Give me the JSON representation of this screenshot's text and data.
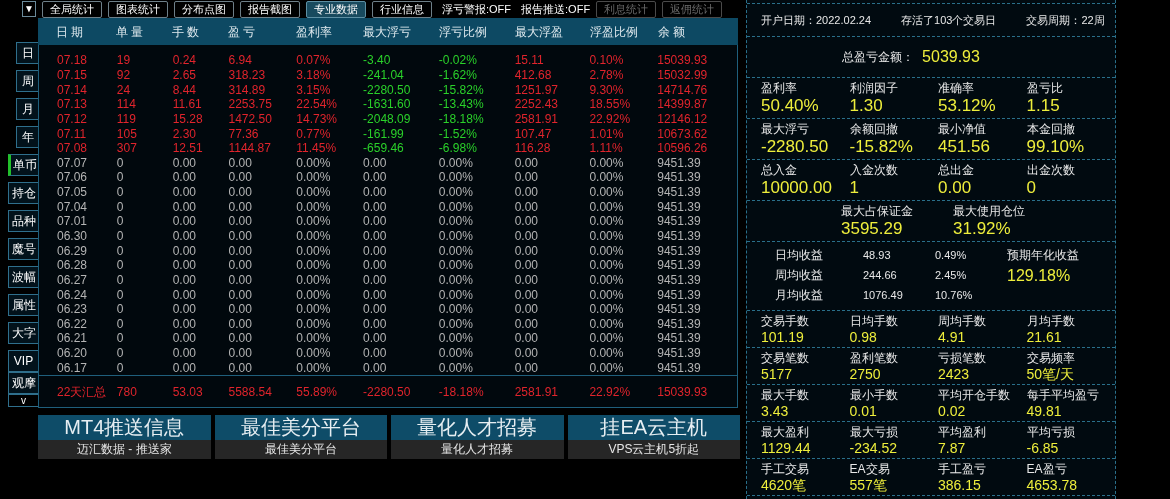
{
  "toolbar": {
    "menu_button": "▼",
    "buttons": [
      {
        "label": "全局统计",
        "selected": false,
        "disabled": false
      },
      {
        "label": "图表统计",
        "selected": false,
        "disabled": false
      },
      {
        "label": "分布点图",
        "selected": false,
        "disabled": false
      },
      {
        "label": "报告截图",
        "selected": false,
        "disabled": false
      },
      {
        "label": "专业数据",
        "selected": true,
        "disabled": false
      },
      {
        "label": "行业信息",
        "selected": false,
        "disabled": false
      }
    ],
    "statuses": [
      "浮亏警报:OFF",
      "报告推送:OFF"
    ],
    "extra_buttons": [
      {
        "label": "利息统计",
        "selected": false,
        "disabled": true
      },
      {
        "label": "返佣统计",
        "selected": false,
        "disabled": true
      }
    ]
  },
  "sidebar": {
    "period_tabs": [
      {
        "label": "日",
        "selected": false
      },
      {
        "label": "周",
        "selected": false
      },
      {
        "label": "月",
        "selected": false
      },
      {
        "label": "年",
        "selected": false
      }
    ],
    "view_tabs": [
      {
        "label": "单币",
        "selected": true
      },
      {
        "label": "持仓",
        "selected": false
      },
      {
        "label": "品种",
        "selected": false
      },
      {
        "label": "魔号",
        "selected": false
      },
      {
        "label": "波幅",
        "selected": false
      },
      {
        "label": "属性",
        "selected": false
      },
      {
        "label": "大字",
        "selected": false
      },
      {
        "label": "VIP",
        "selected": false
      },
      {
        "label": "观摩",
        "selected": false
      }
    ],
    "more": "v"
  },
  "table": {
    "columns": [
      "日 期",
      "单 量",
      "手 数",
      "盈 亏",
      "盈利率",
      "最大浮亏",
      "浮亏比例",
      "最大浮盈",
      "浮盈比例",
      "余 额"
    ],
    "rows": [
      {
        "kind": "trade",
        "cells": [
          "07.18",
          "19",
          "0.24",
          "6.94",
          "0.07%",
          "-3.40",
          "-0.02%",
          "15.11",
          "0.10%",
          "15039.93"
        ]
      },
      {
        "kind": "trade",
        "cells": [
          "07.15",
          "92",
          "2.65",
          "318.23",
          "3.18%",
          "-241.04",
          "-1.62%",
          "412.68",
          "2.78%",
          "15032.99"
        ]
      },
      {
        "kind": "trade",
        "cells": [
          "07.14",
          "24",
          "8.44",
          "314.89",
          "3.15%",
          "-2280.50",
          "-15.82%",
          "1251.97",
          "9.30%",
          "14714.76"
        ]
      },
      {
        "kind": "trade",
        "cells": [
          "07.13",
          "114",
          "11.61",
          "2253.75",
          "22.54%",
          "-1631.60",
          "-13.43%",
          "2252.43",
          "18.55%",
          "14399.87"
        ]
      },
      {
        "kind": "trade",
        "cells": [
          "07.12",
          "119",
          "15.28",
          "1472.50",
          "14.73%",
          "-2048.09",
          "-18.18%",
          "2581.91",
          "22.92%",
          "12146.12"
        ]
      },
      {
        "kind": "trade",
        "cells": [
          "07.11",
          "105",
          "2.30",
          "77.36",
          "0.77%",
          "-161.99",
          "-1.52%",
          "107.47",
          "1.01%",
          "10673.62"
        ]
      },
      {
        "kind": "trade",
        "cells": [
          "07.08",
          "307",
          "12.51",
          "1144.87",
          "11.45%",
          "-659.46",
          "-6.98%",
          "116.28",
          "1.11%",
          "10596.26"
        ]
      },
      {
        "kind": "idle",
        "cells": [
          "07.07",
          "0",
          "0.00",
          "0.00",
          "0.00%",
          "0.00",
          "0.00%",
          "0.00",
          "0.00%",
          "9451.39"
        ]
      },
      {
        "kind": "idle",
        "cells": [
          "07.06",
          "0",
          "0.00",
          "0.00",
          "0.00%",
          "0.00",
          "0.00%",
          "0.00",
          "0.00%",
          "9451.39"
        ]
      },
      {
        "kind": "idle",
        "cells": [
          "07.05",
          "0",
          "0.00",
          "0.00",
          "0.00%",
          "0.00",
          "0.00%",
          "0.00",
          "0.00%",
          "9451.39"
        ]
      },
      {
        "kind": "idle",
        "cells": [
          "07.04",
          "0",
          "0.00",
          "0.00",
          "0.00%",
          "0.00",
          "0.00%",
          "0.00",
          "0.00%",
          "9451.39"
        ]
      },
      {
        "kind": "idle",
        "cells": [
          "07.01",
          "0",
          "0.00",
          "0.00",
          "0.00%",
          "0.00",
          "0.00%",
          "0.00",
          "0.00%",
          "9451.39"
        ]
      },
      {
        "kind": "idle",
        "cells": [
          "06.30",
          "0",
          "0.00",
          "0.00",
          "0.00%",
          "0.00",
          "0.00%",
          "0.00",
          "0.00%",
          "9451.39"
        ]
      },
      {
        "kind": "idle",
        "cells": [
          "06.29",
          "0",
          "0.00",
          "0.00",
          "0.00%",
          "0.00",
          "0.00%",
          "0.00",
          "0.00%",
          "9451.39"
        ]
      },
      {
        "kind": "idle",
        "cells": [
          "06.28",
          "0",
          "0.00",
          "0.00",
          "0.00%",
          "0.00",
          "0.00%",
          "0.00",
          "0.00%",
          "9451.39"
        ]
      },
      {
        "kind": "idle",
        "cells": [
          "06.27",
          "0",
          "0.00",
          "0.00",
          "0.00%",
          "0.00",
          "0.00%",
          "0.00",
          "0.00%",
          "9451.39"
        ]
      },
      {
        "kind": "idle",
        "cells": [
          "06.24",
          "0",
          "0.00",
          "0.00",
          "0.00%",
          "0.00",
          "0.00%",
          "0.00",
          "0.00%",
          "9451.39"
        ]
      },
      {
        "kind": "idle",
        "cells": [
          "06.23",
          "0",
          "0.00",
          "0.00",
          "0.00%",
          "0.00",
          "0.00%",
          "0.00",
          "0.00%",
          "9451.39"
        ]
      },
      {
        "kind": "idle",
        "cells": [
          "06.22",
          "0",
          "0.00",
          "0.00",
          "0.00%",
          "0.00",
          "0.00%",
          "0.00",
          "0.00%",
          "9451.39"
        ]
      },
      {
        "kind": "idle",
        "cells": [
          "06.21",
          "0",
          "0.00",
          "0.00",
          "0.00%",
          "0.00",
          "0.00%",
          "0.00",
          "0.00%",
          "9451.39"
        ]
      },
      {
        "kind": "idle",
        "cells": [
          "06.20",
          "0",
          "0.00",
          "0.00",
          "0.00%",
          "0.00",
          "0.00%",
          "0.00",
          "0.00%",
          "9451.39"
        ]
      },
      {
        "kind": "idle",
        "cells": [
          "06.17",
          "0",
          "0.00",
          "0.00",
          "0.00%",
          "0.00",
          "0.00%",
          "0.00",
          "0.00%",
          "9451.39"
        ]
      }
    ],
    "summary": [
      "22天汇总",
      "780",
      "53.03",
      "5588.54",
      "55.89%",
      "-2280.50",
      "-18.18%",
      "2581.91",
      "22.92%",
      "15039.93"
    ]
  },
  "ads": [
    {
      "title": "MT4推送信息",
      "subtitle": "迈汇数据 - 推送家"
    },
    {
      "title": "最佳美分平台",
      "subtitle": "最佳美分平台"
    },
    {
      "title": "量化人才招募",
      "subtitle": "量化人才招募"
    },
    {
      "title": "挂EA云主机",
      "subtitle": "VPS云主机5折起"
    }
  ],
  "report": {
    "account": [
      "开户日期：2022.02.24",
      "存活了103个交易日",
      "交易周期：22周"
    ],
    "total": {
      "label": "总盈亏金额：",
      "value": "5039.93"
    },
    "sections": [
      {
        "kind": "grid",
        "items": [
          {
            "label": "盈利率",
            "value": "50.40%"
          },
          {
            "label": "利润因子",
            "value": "1.30"
          },
          {
            "label": "准确率",
            "value": "53.12%"
          },
          {
            "label": "盈亏比",
            "value": "1.15"
          }
        ]
      },
      {
        "kind": "grid",
        "items": [
          {
            "label": "最大浮亏",
            "value": "-2280.50"
          },
          {
            "label": "余额回撤",
            "value": "-15.82%"
          },
          {
            "label": "最小净值",
            "value": "451.56"
          },
          {
            "label": "本金回撤",
            "value": "99.10%"
          }
        ]
      },
      {
        "kind": "grid",
        "items": [
          {
            "label": "总入金",
            "value": "10000.00"
          },
          {
            "label": "入金次数",
            "value": "1"
          },
          {
            "label": "总出金",
            "value": "0.00"
          },
          {
            "label": "出金次数",
            "value": "0"
          }
        ]
      },
      {
        "kind": "pair",
        "items": [
          {
            "label": "最大占保证金",
            "value": "3595.29"
          },
          {
            "label": "最大使用仓位",
            "value": "31.92%"
          }
        ]
      },
      {
        "kind": "averages",
        "rows": [
          [
            "日均收益",
            "48.93",
            "0.49%"
          ],
          [
            "周均收益",
            "244.66",
            "2.45%"
          ],
          [
            "月均收益",
            "1076.49",
            "10.76%"
          ]
        ],
        "annual": {
          "label": "预期年化收益",
          "value": "129.18%"
        }
      },
      {
        "kind": "small_grid",
        "items": [
          {
            "label": "交易手数",
            "value": "101.19"
          },
          {
            "label": "日均手数",
            "value": "0.98"
          },
          {
            "label": "周均手数",
            "value": "4.91"
          },
          {
            "label": "月均手数",
            "value": "21.61"
          }
        ]
      },
      {
        "kind": "small_grid",
        "items": [
          {
            "label": "交易笔数",
            "value": "5177"
          },
          {
            "label": "盈利笔数",
            "value": "2750"
          },
          {
            "label": "亏损笔数",
            "value": "2423"
          },
          {
            "label": "交易频率",
            "value": "50笔/天"
          }
        ]
      },
      {
        "kind": "small_grid",
        "items": [
          {
            "label": "最大手数",
            "value": "3.43"
          },
          {
            "label": "最小手数",
            "value": "0.01"
          },
          {
            "label": "平均开仓手数",
            "value": "0.02"
          },
          {
            "label": "每手平均盈亏",
            "value": "49.81"
          }
        ]
      },
      {
        "kind": "small_grid",
        "items": [
          {
            "label": "最大盈利",
            "value": "1129.44"
          },
          {
            "label": "最大亏损",
            "value": "-234.52"
          },
          {
            "label": "平均盈利",
            "value": "7.87"
          },
          {
            "label": "平均亏损",
            "value": "-6.85"
          }
        ]
      },
      {
        "kind": "small_grid",
        "items": [
          {
            "label": "手工交易",
            "value": "4620笔"
          },
          {
            "label": "EA交易",
            "value": "557笔"
          },
          {
            "label": "手工盈亏",
            "value": "386.15"
          },
          {
            "label": "EA盈亏",
            "value": "4653.78"
          }
        ]
      }
    ]
  }
}
